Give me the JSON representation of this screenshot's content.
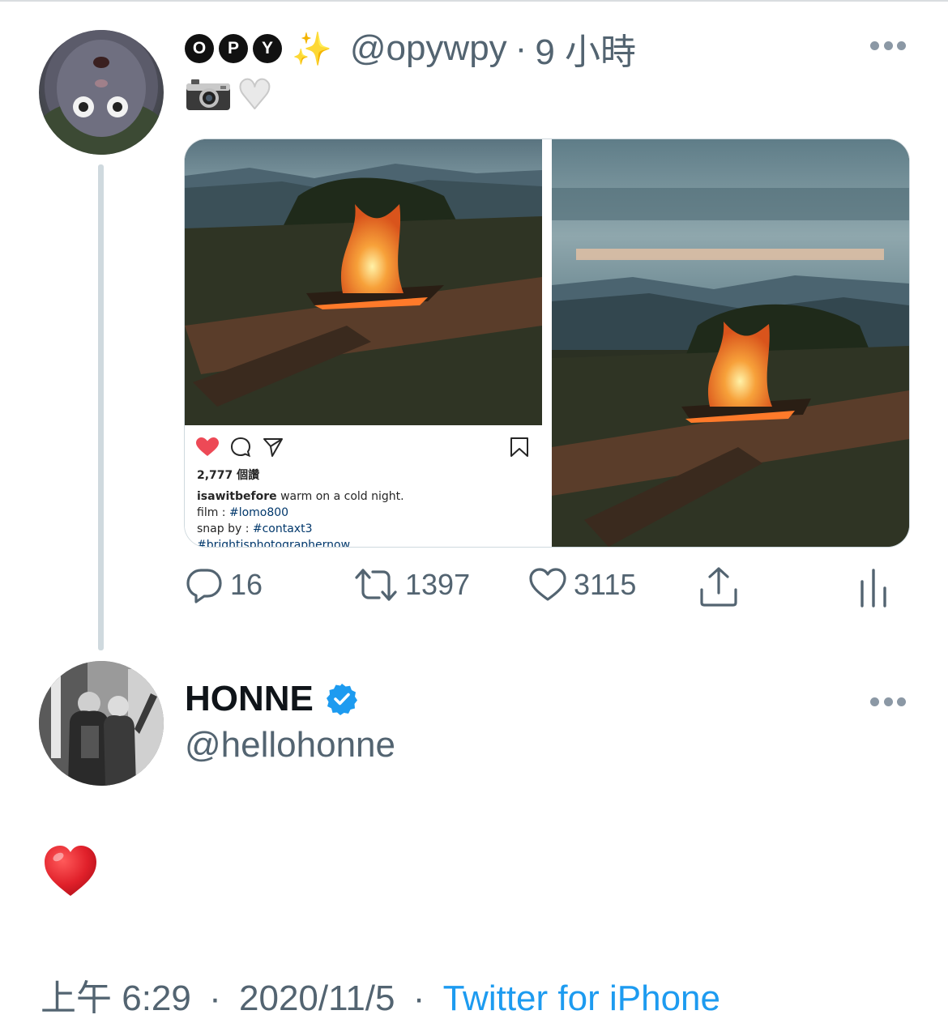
{
  "parent_tweet": {
    "name_badges": [
      "O",
      "P",
      "Y"
    ],
    "sparkle": "✨",
    "handle": "@opywpy",
    "time_sep": "·",
    "time": "9 小時",
    "body_emojis": [
      "camera-icon",
      "white-heart-icon"
    ],
    "media": {
      "instagram_card": {
        "likes": "2,777 個讚",
        "username": "isawitbefore",
        "caption": " warm on a cold night.",
        "film_label": "film : ",
        "film_tag": "#lomo800",
        "snap_label": "snap by : ",
        "snap_tag": "#contaxt3",
        "hashtag": "#brightisphotographernow"
      }
    },
    "actions": {
      "replies": "16",
      "retweets": "1397",
      "likes": "3115"
    }
  },
  "focused_tweet": {
    "display_name": "HONNE",
    "verified": true,
    "handle": "@hellohonne",
    "body": "❤️",
    "timestamp": "上午 6:29",
    "sep": "·",
    "date": "2020/11/5",
    "source": "Twitter for iPhone"
  },
  "colors": {
    "accent": "#1d9bf0",
    "secondary_text": "#536471",
    "heart_red": "#e0245e"
  }
}
